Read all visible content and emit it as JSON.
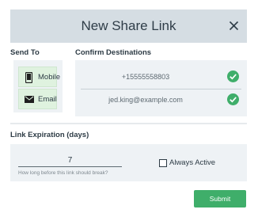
{
  "dialog": {
    "title": "New Share Link",
    "close_icon": "close-icon"
  },
  "send_to": {
    "heading": "Send To",
    "options": [
      {
        "label": "Mobile",
        "icon": "mobile-phone-icon"
      },
      {
        "label": "Email",
        "icon": "envelope-icon"
      }
    ]
  },
  "confirm": {
    "heading": "Confirm Destinations",
    "destinations": [
      {
        "value": "+15555558803",
        "icon": "check-circle-icon"
      },
      {
        "value": "jed.king@example.com",
        "icon": "check-circle-icon"
      }
    ],
    "check_color": "#3fae6a"
  },
  "expiration": {
    "heading": "Link Expiration (days)",
    "value": "7",
    "help": "How long before this link should break?",
    "always_active_label": "Always Active",
    "always_active_checked": false
  },
  "submit_label": "Submit",
  "colors": {
    "header_bg": "#d5dde3",
    "panel_bg": "#eef2f5",
    "option_bg": "#dff2df",
    "submit_bg": "#3fae6a"
  }
}
